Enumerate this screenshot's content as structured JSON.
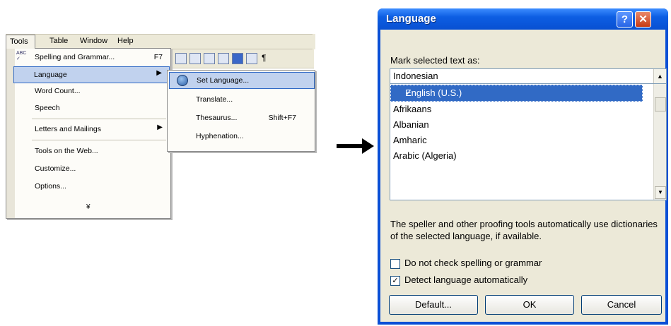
{
  "menubar": {
    "tools": "Tools",
    "table": "Table",
    "window": "Window",
    "help": "Help"
  },
  "tools_menu": {
    "items": [
      {
        "label": "Spelling and Grammar...",
        "shortcut": "F7"
      },
      {
        "label": "Language"
      },
      {
        "label": "Word Count..."
      },
      {
        "label": "Speech"
      },
      {
        "label": "Letters and Mailings"
      },
      {
        "label": "Tools on the Web..."
      },
      {
        "label": "Customize..."
      },
      {
        "label": "Options..."
      }
    ],
    "more": "¥"
  },
  "language_submenu": {
    "items": [
      {
        "label": "Set Language..."
      },
      {
        "label": "Translate..."
      },
      {
        "label": "Thesaurus...",
        "shortcut": "Shift+F7"
      },
      {
        "label": "Hyphenation..."
      }
    ]
  },
  "dialog": {
    "title": "Language",
    "help_glyph": "?",
    "close_glyph": "✕",
    "mark_label": "Mark selected text as:",
    "combo_value": "Indonesian",
    "list_items": [
      "English (U.S.)",
      "Afrikaans",
      "Albanian",
      "Amharic",
      "Arabic (Algeria)"
    ],
    "description": "The speller and other proofing tools automatically use dictionaries of the selected language, if available.",
    "checkbox_no_check": {
      "label": "Do not check spelling or grammar",
      "checked": false
    },
    "checkbox_detect": {
      "label": "Detect language automatically",
      "checked": true
    },
    "buttons": {
      "default": "Default...",
      "ok": "OK",
      "cancel": "Cancel"
    }
  },
  "colors": {
    "title_blue": "#0a4fd6",
    "highlight": "#316ac5",
    "menu_highlight": "#c1d2ee",
    "dialog_face": "#ece9d8"
  }
}
